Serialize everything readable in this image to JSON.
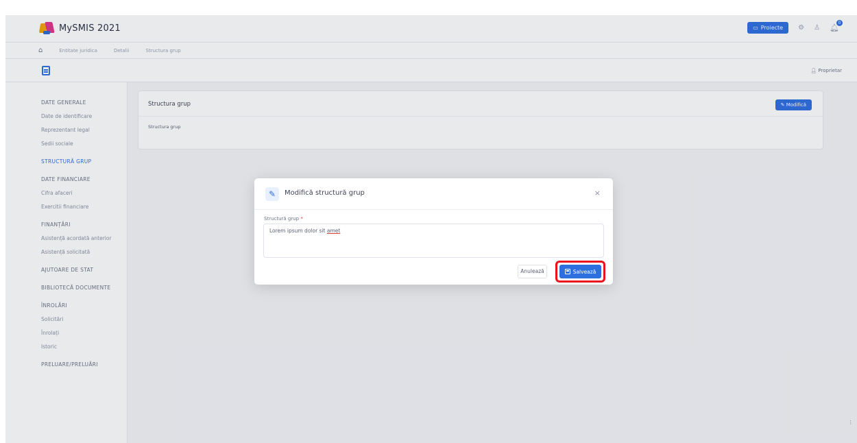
{
  "app": {
    "title": "MySMIS 2021"
  },
  "topbar": {
    "projects_button": "Proiecte",
    "notifications_count": "0"
  },
  "breadcrumb": [
    "Entitate juridica",
    "Detalii",
    "Structura grup"
  ],
  "subheader": {
    "owner_label": "Proprietar"
  },
  "sidebar": {
    "sections": [
      {
        "label": "DATE GENERALE",
        "active": false,
        "items": [
          "Date de identificare",
          "Reprezentant legal",
          "Sedii sociale"
        ]
      },
      {
        "label": "STRUCTURĂ GRUP",
        "active": true,
        "items": []
      },
      {
        "label": "DATE FINANCIARE",
        "active": false,
        "items": [
          "Cifra afaceri",
          "Exercitii financiare"
        ]
      },
      {
        "label": "FINANȚĂRI",
        "active": false,
        "items": [
          "Asistență acordată anterior",
          "Asistență solicitată"
        ]
      },
      {
        "label": "AJUTOARE DE STAT",
        "active": false,
        "items": []
      },
      {
        "label": "BIBLIOTECĂ DOCUMENTE",
        "active": false,
        "items": []
      },
      {
        "label": "ÎNROLĂRI",
        "active": false,
        "items": [
          "Solicitări",
          "Înrolați",
          "Istoric"
        ]
      },
      {
        "label": "PRELUARE/PRELUĂRI",
        "active": false,
        "items": []
      }
    ]
  },
  "card": {
    "title": "Structura grup",
    "subtitle": "Structura grup",
    "edit_button": "Modifică"
  },
  "modal": {
    "title": "Modifică structură grup",
    "field_label": "Structură grup",
    "field_required": "*",
    "field_value_main": "Lorem ipsum dolor sit ",
    "field_value_tail": "amet",
    "cancel_button": "Anulează",
    "save_button": "Salvează",
    "close_symbol": "×"
  },
  "colors": {
    "primary": "#2e6fe0",
    "highlight": "#e8131c"
  }
}
